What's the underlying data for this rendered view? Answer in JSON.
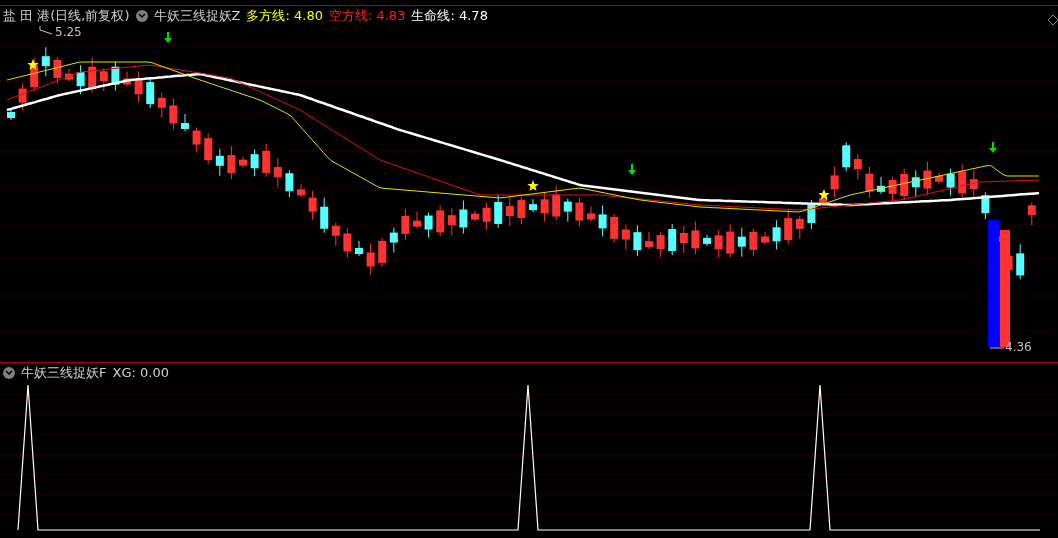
{
  "main_chart": {
    "stock": "盐 田 港(日线,前复权)",
    "indicator": {
      "name": "牛妖三线捉妖Z",
      "items": [
        {
          "label": "多方线:",
          "value": "4.80",
          "color": "#ffff00"
        },
        {
          "label": "空方线:",
          "value": "4.83",
          "color": "#ff2020"
        },
        {
          "label": "生命线:",
          "value": "4.78",
          "color": "#ffffff"
        }
      ]
    },
    "high_label": "5.25",
    "low_label": "4.36"
  },
  "sub_chart": {
    "indicator": {
      "name": "牛妖三线捉妖F",
      "items": [
        {
          "label": "XG:",
          "value": "0.00"
        }
      ]
    }
  }
}
